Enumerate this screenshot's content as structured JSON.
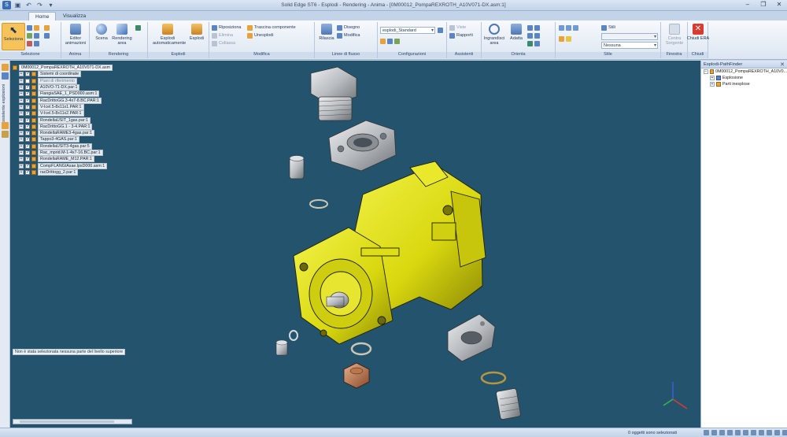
{
  "window": {
    "title": "Solid Edge ST6 - Esplodi - Rendering - Anima - [0M00012_PompaREXROTH_A10V071-DX.asm:1]",
    "controls": {
      "minimize": "–",
      "restore": "❐",
      "close": "✕"
    }
  },
  "tabs": [
    {
      "label": "Home",
      "active": true
    },
    {
      "label": "Visualizza",
      "active": false
    }
  ],
  "ribbon": {
    "groups": {
      "selection": "Selezione",
      "animation": "Anima",
      "rendering": "Rendering",
      "explode": "Esplodi",
      "modify": "Modifica",
      "flowlines": "Linee di flusso",
      "configurations": "Configurazioni",
      "assistants": "Assistenti",
      "orient": "Orienta",
      "style": "Stile",
      "window": "Finestra",
      "close": "Chiudi"
    },
    "buttons": {
      "select": "Seleziona",
      "animation_editor": "Editor animazioni",
      "scene": "Scena",
      "render_area": "Rendering area",
      "auto_explode": "Esplodi automaticamente",
      "explode": "Esplodi",
      "reposition": "Riposiziona",
      "delete": "Elimina",
      "collapse": "Collassa",
      "drag_component": "Trascina componente",
      "unexplode": "Unesplodi",
      "bind": "Rilascia",
      "draw": "Disegno",
      "modify": "Modifica",
      "fit_area": "Ingrandisci area",
      "fit": "Adatta",
      "reports": "Rapporti",
      "views": "Viste",
      "center_source": "Centra Sorgente",
      "close_era": "Chiudi ERA"
    },
    "config_combo": "esplodi_Standard",
    "style_label": "Stili",
    "style_combo": "Nessuna"
  },
  "left_strip": {
    "label": "Assistente esplosioni"
  },
  "tree": {
    "root": "0M00012_PompaREXROTH_A10V071-DX.asm",
    "items": [
      {
        "label": "Sistemi di coordinate",
        "checked": true,
        "faded": false
      },
      {
        "label": "Piani di riferimento",
        "checked": false,
        "faded": true
      },
      {
        "label": "A10VO-71-DX.par:1",
        "checked": true,
        "faded": false
      },
      {
        "label": "FlangiaSAE_1_PSD000.asm:1",
        "checked": true,
        "faded": false
      },
      {
        "label": "RacDrittoGG.3-4x7-8.BC.PAR:1",
        "checked": true,
        "faded": false
      },
      {
        "label": "V-Icel.5-8x11x1.PAR:1",
        "checked": true,
        "faded": false
      },
      {
        "label": "V-Icel.5-8x11x2.PAR:1",
        "checked": true,
        "faded": false
      },
      {
        "label": "RondellaUSIT_1gas.par:1",
        "checked": true,
        "faded": false
      },
      {
        "label": "RacDrittoGG.1 - 3-4.PAR:1",
        "checked": true,
        "faded": false
      },
      {
        "label": "RondellaRAME3-4gas.par:1",
        "checked": true,
        "faded": false
      },
      {
        "label": "Tappo3-4GAS.par:1",
        "checked": true,
        "faded": false
      },
      {
        "label": "RondellaUSIT3-4gas.par:5",
        "checked": true,
        "faded": false
      },
      {
        "label": "Rac_mprid.M-1-4x7-16.BC.par:1",
        "checked": true,
        "faded": false
      },
      {
        "label": "RondellaRAME_M12.PAR:1",
        "checked": true,
        "faded": false
      },
      {
        "label": "CompFLANGIAsae.lpsD000.asm:1",
        "checked": true,
        "faded": false
      },
      {
        "label": "racDrittogg_2.par:1",
        "checked": true,
        "faded": false
      }
    ],
    "note": "Non è stata selezionata nessuna parte del livello superiore"
  },
  "pathfinder": {
    "title": "Esplodi-PathFinder",
    "root": "0M00012_PompaREXROTH_A10V0...",
    "items": [
      {
        "label": "Esplosione"
      },
      {
        "label": "Parti inesplose"
      }
    ]
  },
  "statusbar": {
    "message": "0 oggetti sono selezionati"
  },
  "colors": {
    "viewport_bg": "#24536d",
    "part_yellow": "#e6e41a",
    "metal": "#c7c9cc",
    "ribbon_accent": "#3b6db5"
  }
}
